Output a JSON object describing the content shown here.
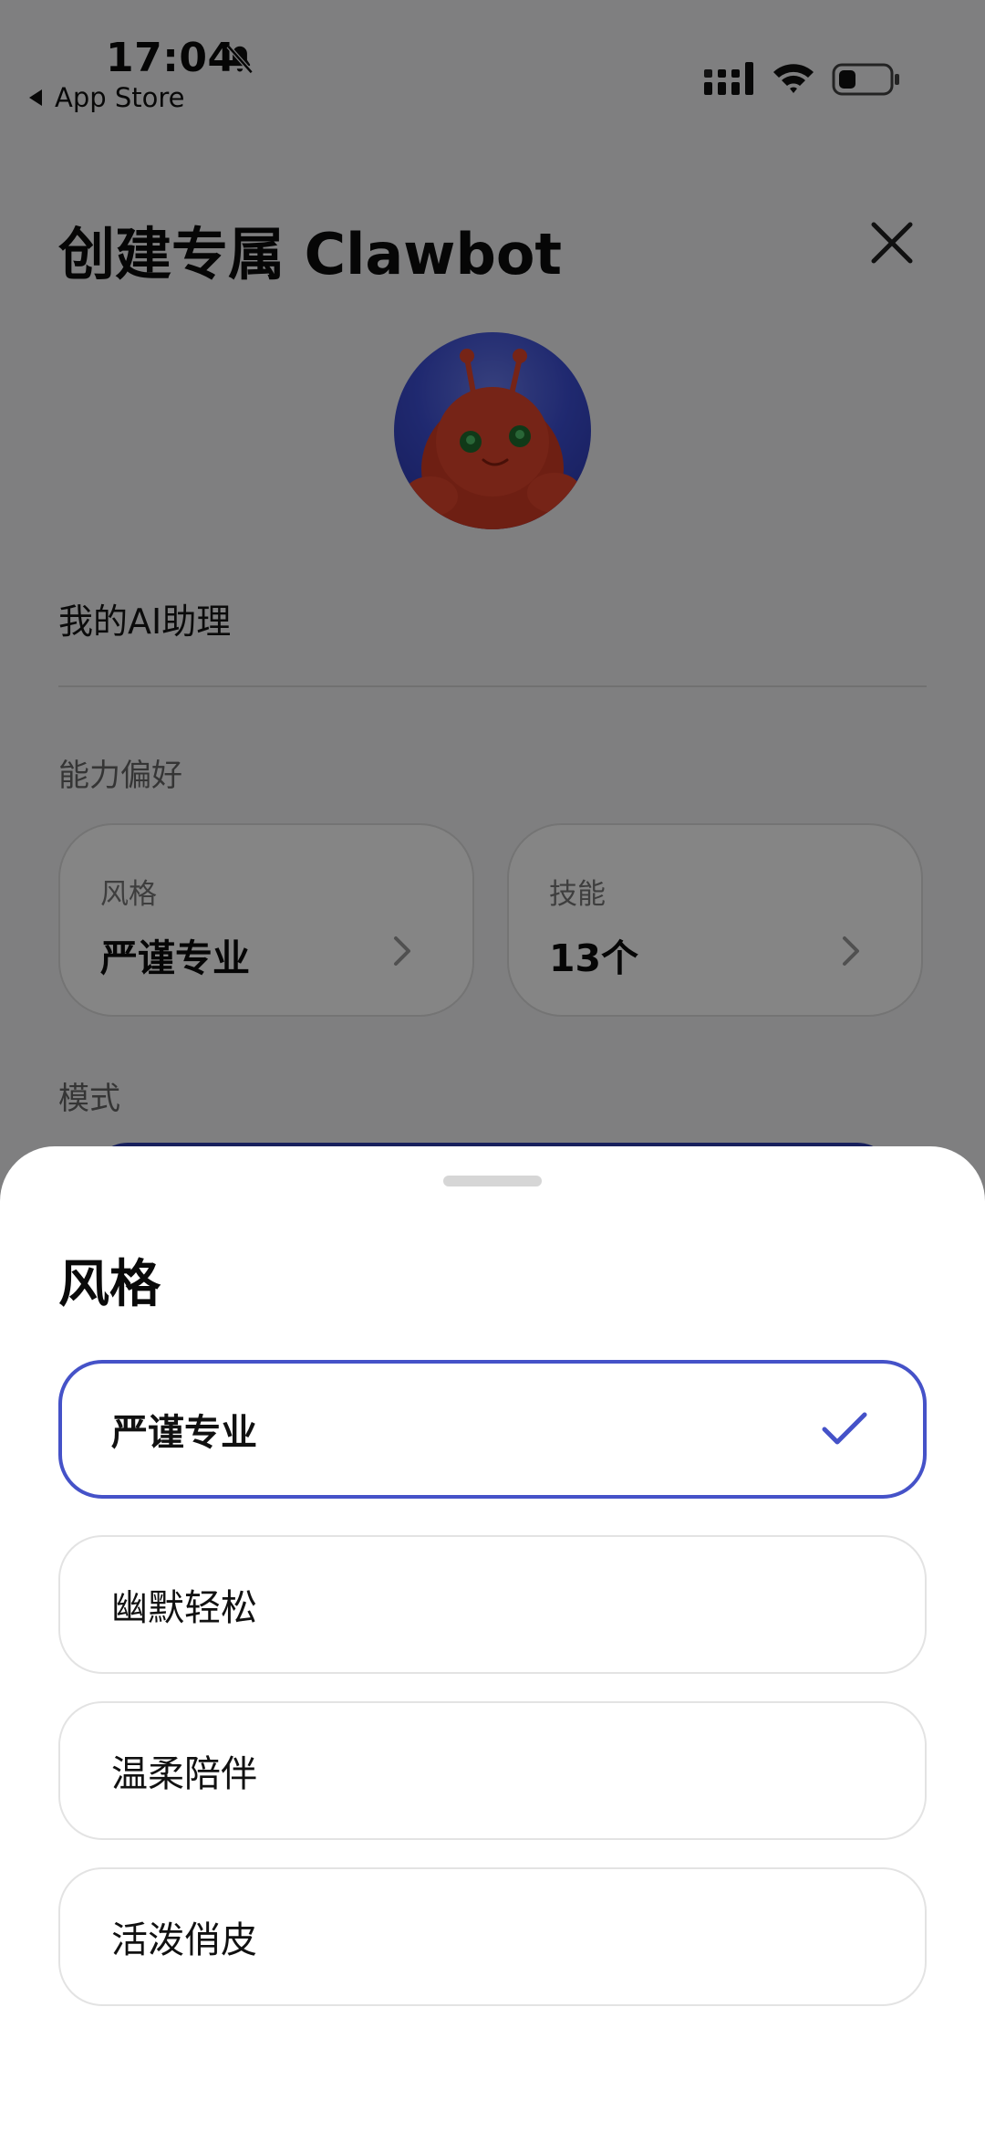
{
  "status_bar": {
    "time": "17:04",
    "back_label": "App Store"
  },
  "page": {
    "title": "创建专属 Clawbot",
    "assistant_name": "我的AI助理",
    "ability_section_label": "能力偏好",
    "mode_section_label": "模式",
    "style_card": {
      "label": "风格",
      "value": "严谨专业"
    },
    "skills_card": {
      "label": "技能",
      "value": "13个"
    }
  },
  "sheet": {
    "title": "风格",
    "options": [
      {
        "label": "严谨专业",
        "selected": true
      },
      {
        "label": "幽默轻松",
        "selected": false
      },
      {
        "label": "温柔陪伴",
        "selected": false
      },
      {
        "label": "活泼俏皮",
        "selected": false
      }
    ]
  },
  "colors": {
    "accent": "#4552c8",
    "overlay": "rgba(0,0,0,0.48)",
    "avatar_bg": "#3d4fd6",
    "mascot": "#e2452c"
  },
  "icons": {
    "notifications_muted": "bell-slash-icon",
    "close": "close-icon",
    "chevron": "chevron-right-icon",
    "check": "check-icon"
  }
}
